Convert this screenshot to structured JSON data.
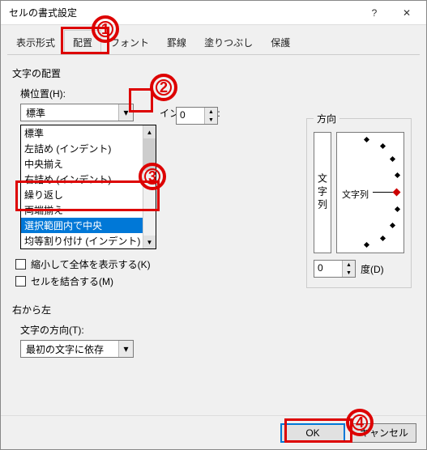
{
  "window": {
    "title": "セルの書式設定",
    "help": "?",
    "close": "✕"
  },
  "tabs": [
    "表示形式",
    "配置",
    "フォント",
    "罫線",
    "塗りつぶし",
    "保護"
  ],
  "active_tab_index": 1,
  "alignment": {
    "section": "文字の配置",
    "h_label": "横位置(H):",
    "h_value": "標準",
    "indent_label": "インデント(I):",
    "indent_value": "0",
    "options": [
      "標準",
      "左詰め (インデント)",
      "中央揃え",
      "右詰め (インデント)",
      "繰り返し",
      "両端揃え",
      "選択範囲内で中央",
      "均等割り付け (インデント)"
    ],
    "selected_option_index": 6
  },
  "text_control": {
    "shrink": "縮小して全体を表示する(K)",
    "merge": "セルを結合する(M)"
  },
  "rtl": {
    "section": "右から左",
    "dir_label": "文字の方向(T):",
    "dir_value": "最初の文字に依存"
  },
  "orientation": {
    "legend": "方向",
    "vertical_text": "文字列",
    "dial_text": "文字列",
    "degrees_value": "0",
    "degrees_label": "度(D)"
  },
  "footer": {
    "ok": "OK",
    "cancel": "キャンセル"
  },
  "callouts": {
    "n1": "1",
    "n2": "2",
    "n3": "3",
    "n4": "4"
  }
}
